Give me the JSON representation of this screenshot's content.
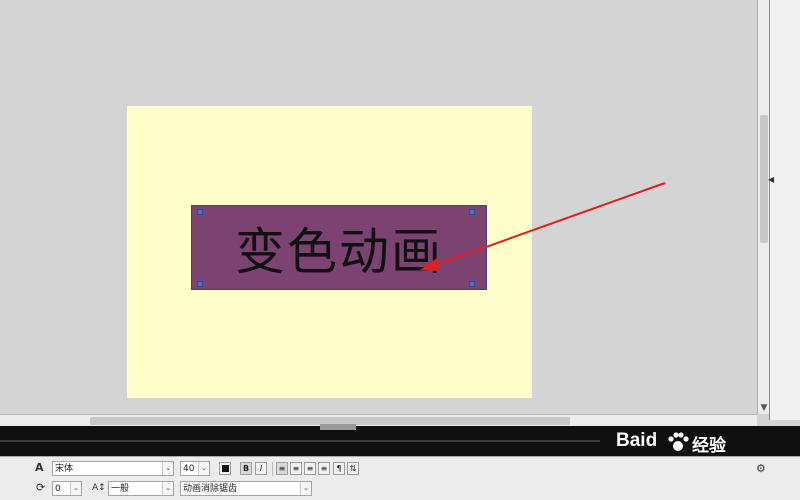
{
  "canvas": {
    "title_text": "变色动画",
    "stage_color": "#ffffcc",
    "textbox_fill": "#7b4272",
    "annotation_arrow_color": "#e02020"
  },
  "properties": {
    "font_family": "宋体",
    "font_size": "40",
    "letter_spacing": "0",
    "char_position": "一般",
    "anti_alias": "动画消除锯齿",
    "buttons": {
      "bold": "B",
      "italic": "I",
      "paragraph": "¶"
    }
  },
  "watermark": {
    "brand": "Baid",
    "sub": "经验"
  },
  "icons": [
    "text-tool-icon",
    "color-swatch-icon",
    "bold-icon",
    "italic-icon",
    "align-left-icon",
    "align-center-icon",
    "align-right-icon",
    "justify-icon",
    "paragraph-icon",
    "text-direction-icon",
    "settings-icon",
    "rotate-icon",
    "letter-spacing-icon",
    "paw-icon",
    "collapse-arrow-icon"
  ]
}
